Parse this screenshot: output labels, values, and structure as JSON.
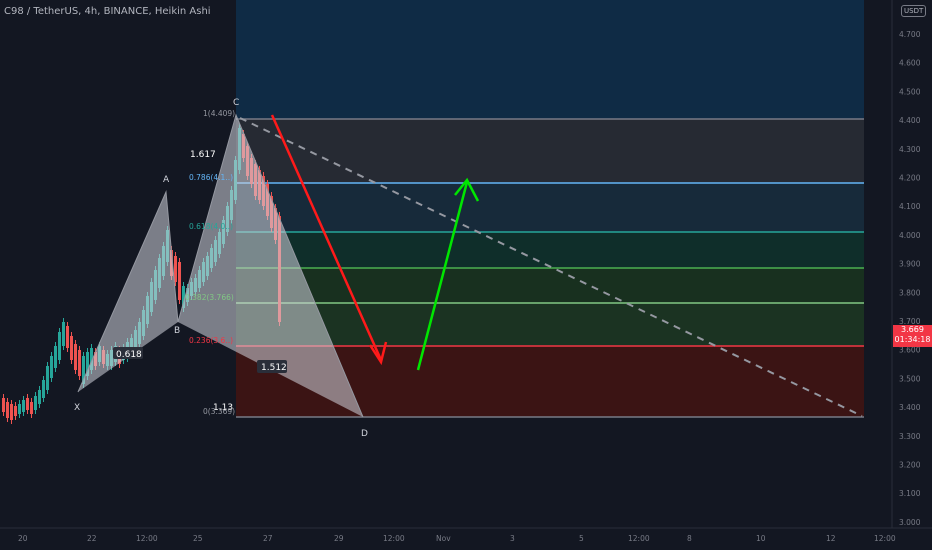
{
  "header": {
    "symbol_title": "C98 / TetherUS, 4h, BINANCE, Heikin Ashi"
  },
  "currency_label": "USDT",
  "price_axis": [
    "4.700",
    "4.600",
    "4.500",
    "4.400",
    "4.300",
    "4.200",
    "4.100",
    "4.000",
    "3.900",
    "3.800",
    "3.700",
    "3.600",
    "3.500",
    "3.400",
    "3.300",
    "3.200",
    "3.100",
    "3.000"
  ],
  "time_axis": [
    "20",
    "22",
    "12:00",
    "25",
    "27",
    "29",
    "12:00",
    "Nov",
    "3",
    "5",
    "12:00",
    "8",
    "10",
    "12",
    "12:00"
  ],
  "current_price": {
    "price": "3.669",
    "countdown": "01:34:18"
  },
  "pattern_points": [
    "X",
    "A",
    "B",
    "C",
    "D"
  ],
  "pattern_ratios": [
    "1.617",
    "0.618",
    "1.512",
    "1.13"
  ],
  "fib_levels": [
    {
      "label": "1(4.409)",
      "color": "#787b86"
    },
    {
      "label": "0.786(4.1..)",
      "color": "#64b5f6"
    },
    {
      "label": "0.618(4.0..)",
      "color": "#26a69a"
    },
    {
      "label": "",
      "color": "#4caf50"
    },
    {
      "label": "0.382(3.766)",
      "color": "#81c784"
    },
    {
      "label": "0.236(3.6..)",
      "color": "#f23645"
    },
    {
      "label": "0(3.369)",
      "color": "#787b86"
    }
  ],
  "colors": {
    "up": "#26a69a",
    "down": "#ef5350",
    "bg": "#131722"
  }
}
